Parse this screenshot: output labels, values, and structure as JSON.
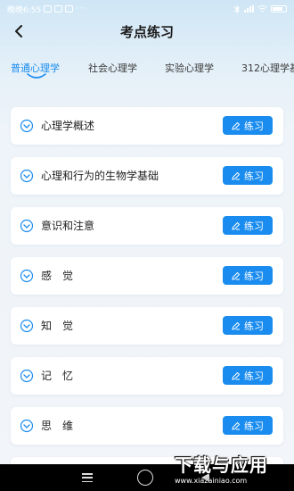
{
  "status_bar": {
    "time": "晚晚6:55",
    "dots": "···"
  },
  "header": {
    "title": "考点练习"
  },
  "tabs": [
    {
      "label": "普通心理学",
      "active": true
    },
    {
      "label": "社会心理学",
      "active": false
    },
    {
      "label": "实验心理学",
      "active": false
    },
    {
      "label": "312心理学基",
      "active": false
    }
  ],
  "items": [
    {
      "label": "心理学概述",
      "button": "练习"
    },
    {
      "label": "心理和行为的生物学基础",
      "button": "练习"
    },
    {
      "label": "意识和注意",
      "button": "练习"
    },
    {
      "label": "感　觉",
      "button": "练习"
    },
    {
      "label": "知　觉",
      "button": "练习"
    },
    {
      "label": "记　忆",
      "button": "练习"
    },
    {
      "label": "思　维",
      "button": "练习"
    }
  ],
  "watermark": {
    "title": "下载与应用",
    "url": "www.xiazainiao.com"
  },
  "colors": {
    "accent": "#1a8cef",
    "background": "#f2f5f9"
  }
}
